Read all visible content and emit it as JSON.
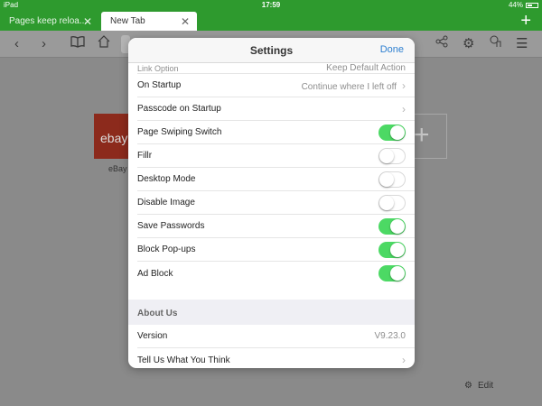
{
  "status_bar": {
    "device": "iPad",
    "time": "17:59",
    "battery": "44%"
  },
  "tabs": [
    {
      "label": "Pages keep reloa...",
      "active": false
    },
    {
      "label": "New Tab",
      "active": true
    }
  ],
  "toolbar": {
    "icons": [
      "back-icon",
      "forward-icon",
      "bookmarks-icon",
      "home-icon",
      "share-icon",
      "settings-icon",
      "gesture-icon",
      "menu-icon"
    ]
  },
  "background": {
    "tile_label": "eBay",
    "tile_text": "ebay",
    "edit_label": "Edit"
  },
  "modal": {
    "title": "Settings",
    "done_label": "Done",
    "cut_label": "Link Option",
    "cut_value": "Keep Default Action",
    "rows": [
      {
        "label": "On Startup",
        "value": "Continue where I left off",
        "type": "nav"
      },
      {
        "label": "Passcode on Startup",
        "value": "",
        "type": "nav"
      },
      {
        "label": "Page Swiping Switch",
        "type": "toggle",
        "on": true
      },
      {
        "label": "Fillr",
        "type": "toggle",
        "on": false
      },
      {
        "label": "Desktop Mode",
        "type": "toggle",
        "on": false
      },
      {
        "label": "Disable Image",
        "type": "toggle",
        "on": false
      },
      {
        "label": "Save Passwords",
        "type": "toggle",
        "on": true
      },
      {
        "label": "Block Pop-ups",
        "type": "toggle",
        "on": true
      },
      {
        "label": "Ad Block",
        "type": "toggle",
        "on": true
      }
    ],
    "section_title": "About Us",
    "about": [
      {
        "label": "Version",
        "value": "V9.23.0",
        "type": "value"
      },
      {
        "label": "Tell Us What You Think",
        "value": "",
        "type": "nav"
      }
    ]
  },
  "colors": {
    "accent": "#2e9a2e",
    "toggle_on": "#4cd964",
    "link": "#2d7fd0"
  }
}
